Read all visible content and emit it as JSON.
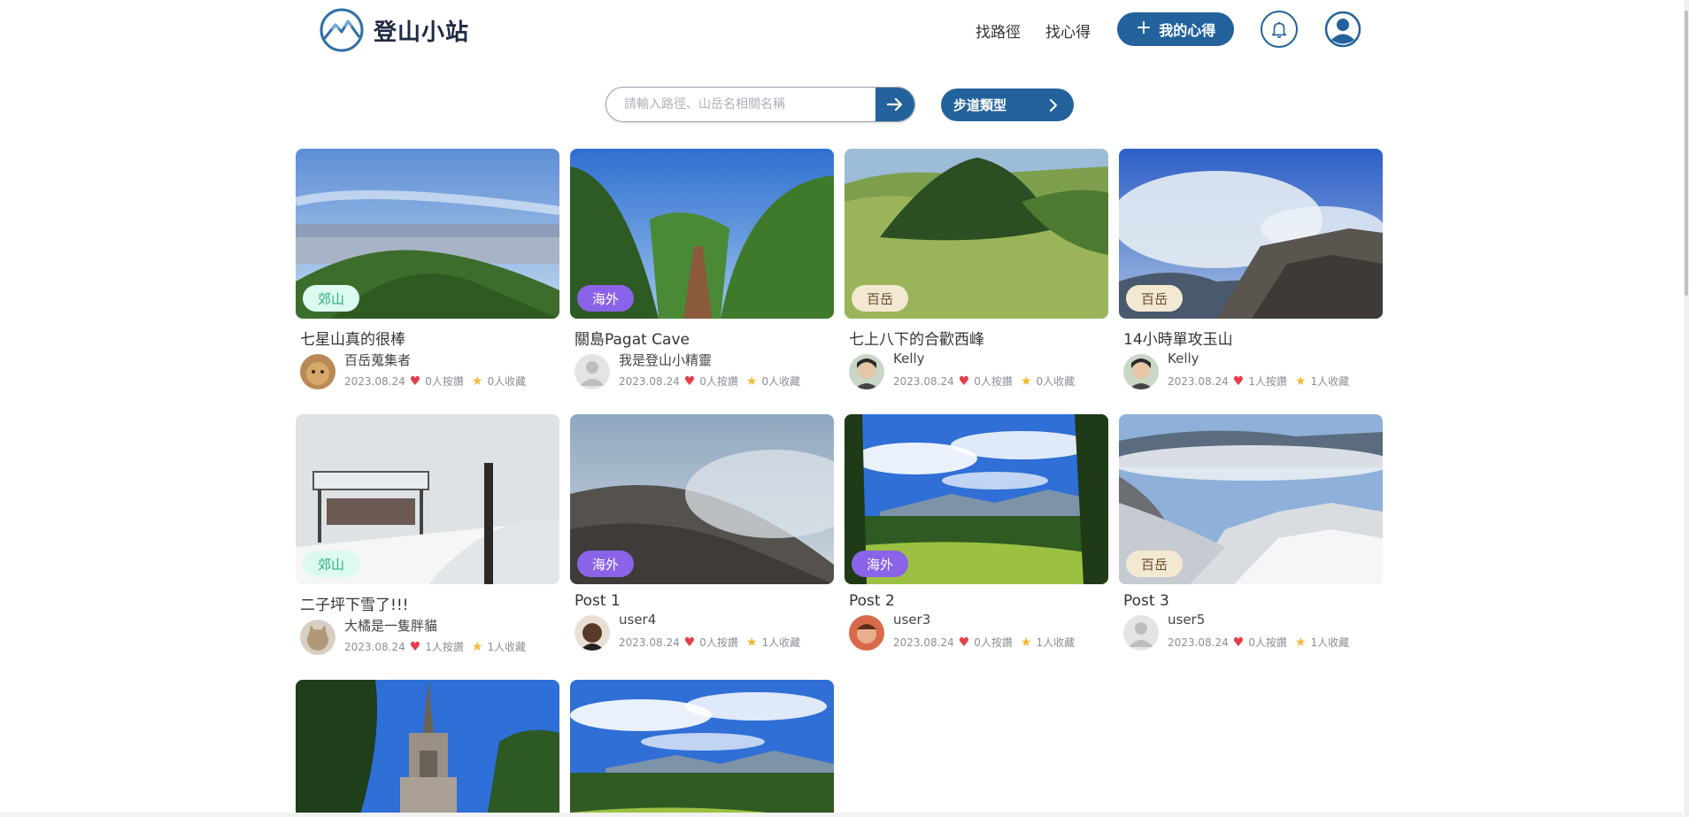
{
  "header": {
    "logo_text": "登山小站",
    "nav": [
      {
        "label": "找路徑"
      },
      {
        "label": "找心得"
      }
    ],
    "my_note_label": "我的心得"
  },
  "search": {
    "placeholder": "請輸入路徑、山岳名相關名稱",
    "type_button_label": "步道類型"
  },
  "cards": [
    {
      "title": "七星山真的很棒",
      "tag": "郊山",
      "tag_style": "green",
      "author": "百岳蒐集者",
      "date": "2023.08.24",
      "likes": "0人按讚",
      "saves": "0人收藏"
    },
    {
      "title": "關島Pagat Cave",
      "tag": "海外",
      "tag_style": "purple",
      "author": "我是登山小精靈",
      "date": "2023.08.24",
      "likes": "0人按讚",
      "saves": "0人收藏"
    },
    {
      "title": "七上八下的合歡西峰",
      "tag": "百岳",
      "tag_style": "beige",
      "author": "Kelly",
      "date": "2023.08.24",
      "likes": "0人按讚",
      "saves": "0人收藏"
    },
    {
      "title": "14小時單攻玉山",
      "tag": "百岳",
      "tag_style": "beige",
      "author": "Kelly",
      "date": "2023.08.24",
      "likes": "1人按讚",
      "saves": "1人收藏"
    },
    {
      "title": "二子坪下雪了!!!",
      "tag": "郊山",
      "tag_style": "green",
      "author": "大橘是一隻胖貓",
      "date": "2023.08.24",
      "likes": "1人按讚",
      "saves": "1人收藏"
    },
    {
      "title": "Post 1",
      "tag": "海外",
      "tag_style": "purple",
      "author": "user4",
      "date": "2023.08.24",
      "likes": "0人按讚",
      "saves": "1人收藏"
    },
    {
      "title": "Post 2",
      "tag": "海外",
      "tag_style": "purple",
      "author": "user3",
      "date": "2023.08.24",
      "likes": "0人按讚",
      "saves": "1人收藏"
    },
    {
      "title": "Post 3",
      "tag": "百岳",
      "tag_style": "beige",
      "author": "user5",
      "date": "2023.08.24",
      "likes": "0人按讚",
      "saves": "1人收藏"
    }
  ],
  "colors": {
    "primary": "#23629c",
    "heart": "#e53e4a",
    "star": "#f5b82e",
    "tag_green_bg": "#dcfaf0",
    "tag_purple_bg": "#8a63e8",
    "tag_beige_bg": "#f3e8d2"
  },
  "icons": [
    "mountain-logo-icon",
    "plus-icon",
    "bell-icon",
    "user-icon",
    "arrow-right-icon",
    "chevron-right-icon",
    "heart-icon",
    "star-icon"
  ]
}
